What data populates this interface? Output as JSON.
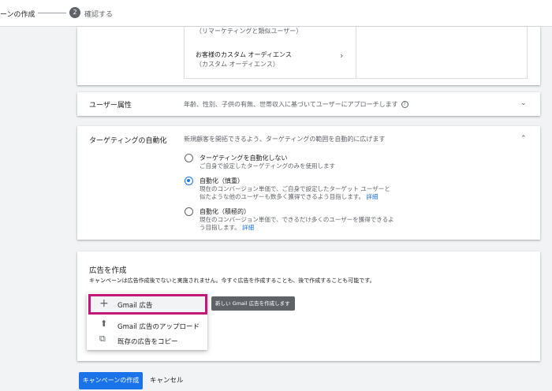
{
  "stepper": {
    "prev_step": "ーンの作成",
    "current_number": "2",
    "current_label": "確認する"
  },
  "audience": {
    "remarketing_subtitle": "（リマーケティングと類似ユーザー）",
    "custom_title": "お客様のカスタム オーディエンス",
    "custom_subtitle": "（カスタム オーディエンス）"
  },
  "demographics": {
    "title": "ユーザー属性",
    "description": "年齢、性別、子供の有無、世帯収入に基づいてユーザーにアプローチします"
  },
  "targeting": {
    "title": "ターゲティングの自動化",
    "description": "新規顧客を開拓できるよう、ターゲティングの範囲を自動的に広げます",
    "options": [
      {
        "title": "ターゲティングを自動化しない",
        "line1": "ご自身で設定したターゲティングのみを使用します",
        "line2": "",
        "selected": false
      },
      {
        "title": "自動化（慎重）",
        "line1": "現在のコンバージョン単価で、ご自身で設定したターゲット ユーザーと",
        "line2": "似たような他のユーザーも数多く獲得できるよう目指します。",
        "link": "詳細",
        "selected": true
      },
      {
        "title": "自動化（積極的）",
        "line1": "現在のコンバージョン単価で、できるだけ多くのユーザーを獲得できるよ",
        "line2": "う目指します。",
        "link": "詳細",
        "selected": false
      }
    ]
  },
  "create_ad": {
    "title": "広告を作成",
    "description": "キャンペーンは広告作成後でないと実施されません。今すぐ広告を作成することも、後で作成することも可能です。",
    "menu": [
      "Gmail 広告",
      "Gmail 広告のアップロード",
      "既存の広告をコピー"
    ],
    "tooltip": "新しい Gmail 広告を作成します"
  },
  "footer": {
    "create_label": "キャンペーンの作成",
    "cancel_label": "キャンセル"
  },
  "colors": {
    "accent": "#1a73e8",
    "highlight": "#c2187c"
  }
}
